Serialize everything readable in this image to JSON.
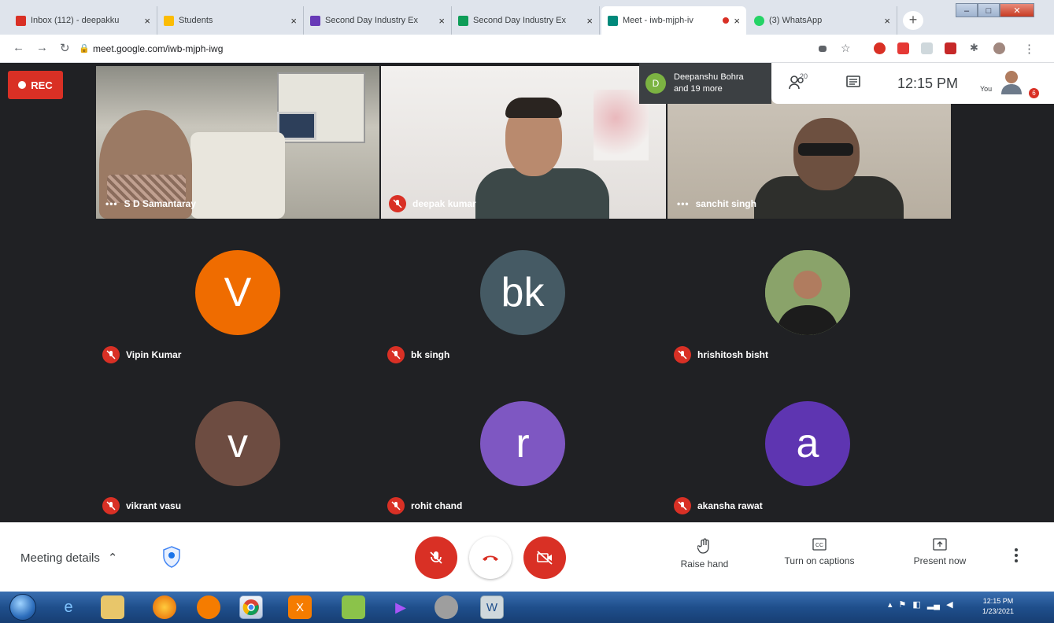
{
  "browser": {
    "tabs": [
      {
        "title": "Inbox (112) - deepakku",
        "fav": "#d93025",
        "fav_icon": "gmail-icon",
        "active": false
      },
      {
        "title": "Students",
        "fav": "#fbbc04",
        "fav_icon": "sheet-icon",
        "active": false
      },
      {
        "title": "Second Day Industry Ex",
        "fav": "#673ab7",
        "fav_icon": "forms-icon",
        "active": false
      },
      {
        "title": "Second Day Industry Ex",
        "fav": "#0f9d58",
        "fav_icon": "sheets-icon",
        "active": false
      },
      {
        "title": "Meet - iwb-mjph-iv",
        "fav": "#00897b",
        "fav_icon": "meet-icon",
        "active": true
      },
      {
        "title": "(3) WhatsApp",
        "fav": "#25d366",
        "fav_icon": "whatsapp-icon",
        "active": false
      }
    ],
    "new_tab": "+",
    "url": "meet.google.com/iwb-mjph-iwg"
  },
  "meet": {
    "rec_label": "REC",
    "top_info": {
      "initial": "D",
      "line1": "Deepanshu Bohra",
      "line2": "and 19 more"
    },
    "people_count": "20",
    "time": "12:15 PM",
    "you_label": "You",
    "notif_count": "6",
    "video_tiles": [
      {
        "name": "S D Samantaray",
        "muted": false
      },
      {
        "name": "deepak kumar",
        "muted": true
      },
      {
        "name": "sanchit singh",
        "muted": false
      }
    ],
    "avatar_tiles": [
      {
        "name": "Vipin Kumar",
        "letter": "V",
        "color": "#ef6c00",
        "photo": false
      },
      {
        "name": "bk singh",
        "letter": "bk",
        "color": "#455a64",
        "photo": false
      },
      {
        "name": "hrishitosh bisht",
        "letter": "",
        "color": "#7a9a5c",
        "photo": true
      },
      {
        "name": "vikrant vasu",
        "letter": "v",
        "color": "#6d4c41",
        "photo": false
      },
      {
        "name": "rohit chand",
        "letter": "r",
        "color": "#7e57c2",
        "photo": false
      },
      {
        "name": "akansha rawat",
        "letter": "a",
        "color": "#5e35b1",
        "photo": false
      }
    ]
  },
  "controls": {
    "meeting_details": "Meeting details",
    "raise_hand": "Raise hand",
    "captions": "Turn on captions",
    "present": "Present now"
  },
  "taskbar": {
    "clock_time": "12:15 PM",
    "clock_date": "1/23/2021"
  },
  "colors": {
    "accent_red": "#d93025",
    "stage_bg": "#202124"
  }
}
